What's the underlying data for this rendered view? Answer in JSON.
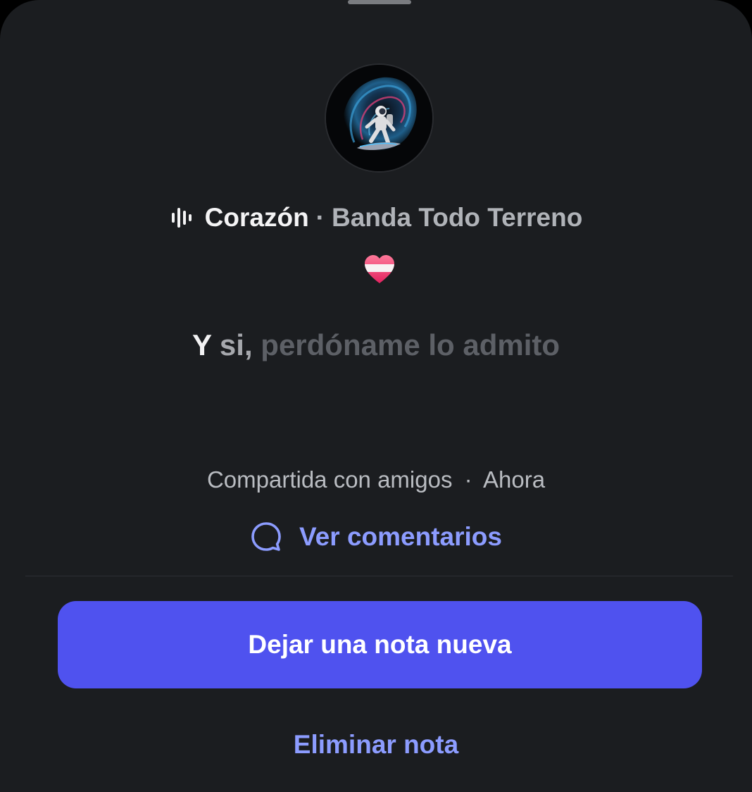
{
  "sheet": {
    "background": "#1b1d20",
    "accent": "#8c9cff",
    "button_color": "#4f52ef"
  },
  "note": {
    "avatar_icon": "astronaut-surfer-avatar",
    "song": {
      "icon": "audio-bars-icon",
      "title": "Corazón",
      "separator": "·",
      "artist": "Banda Todo Terreno"
    },
    "emoji": "heart-emoji",
    "lyric": {
      "part1": "Y",
      "part2": "si,",
      "part3": "perdóname lo admito"
    },
    "meta": {
      "audience": "Compartida con amigos",
      "separator": "·",
      "time": "Ahora"
    }
  },
  "actions": {
    "comments_label": "Ver comentarios",
    "comments_icon": "comment-bubble-icon",
    "new_note_label": "Dejar una nota nueva",
    "delete_label": "Eliminar nota"
  }
}
